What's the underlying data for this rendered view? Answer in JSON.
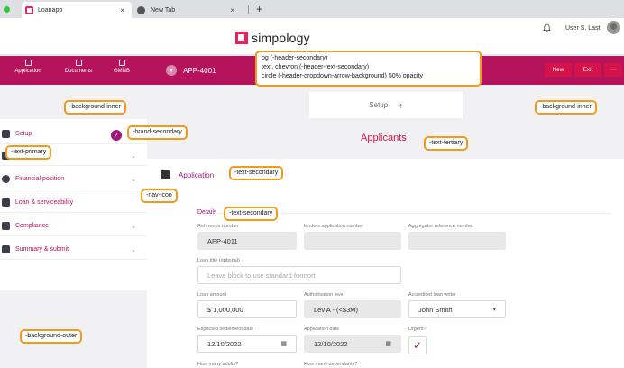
{
  "browser": {
    "tabs": [
      {
        "title": "Loanapp",
        "close": "×"
      },
      {
        "title": "New Tab",
        "close": "×"
      }
    ],
    "new_tab": "+"
  },
  "topbar": {
    "logo_text": "simpology",
    "user_name": "User S. Last"
  },
  "header": {
    "nav": [
      {
        "label": "Application",
        "icon": "application-icon"
      },
      {
        "label": "Documents",
        "icon": "documents-icon"
      },
      {
        "label": "GMNB",
        "icon": "gmnb-icon"
      }
    ],
    "app_id": "APP-4001",
    "buttons": {
      "new": "New",
      "exit": "Exit",
      "more": "···"
    }
  },
  "sidebar": {
    "items": [
      {
        "label": "Setup",
        "chevron": ""
      },
      {
        "label": "",
        "chevron": "⌄"
      },
      {
        "label": "Financial position",
        "chevron": "⌄"
      },
      {
        "label": "Loan & serviceability",
        "chevron": ""
      },
      {
        "label": "Compliance",
        "chevron": "⌄"
      },
      {
        "label": "Summary & submit",
        "chevron": "⌄"
      }
    ]
  },
  "main": {
    "setup_bar": "Setup",
    "setup_arrow": "↑",
    "section_title": "Applicants",
    "application_heading": "Application",
    "details_heading": "Details",
    "fields": {
      "reference_number": {
        "label": "Reference number",
        "value": "APP-4011"
      },
      "lenders_application_number": {
        "label": "lenders application number",
        "value": ""
      },
      "aggregator_reference_number": {
        "label": "Aggregator reference number",
        "value": ""
      },
      "loan_title": {
        "label": "Loan title (optional)",
        "placeholder": "Leave block to use standard formort"
      },
      "loan_amount": {
        "label": "Loan amount",
        "value": "$  1,000,000"
      },
      "authorisation_level": {
        "label": "Authorisation level",
        "value": "Lev A - (<$3M)"
      },
      "accredited_loan_writer": {
        "label": "Accredited loan writer",
        "value": "John Smith"
      },
      "expected_settlement_date": {
        "label": "Expected settlement date",
        "value": "12/10/2022"
      },
      "application_date": {
        "label": "Application date",
        "value": "12/10/2022"
      },
      "urgent": {
        "label": "Urgent?",
        "checked": true
      },
      "how_many_adults": {
        "label": "How many adults?"
      },
      "how_many_dependants": {
        "label": "How many dependants?"
      }
    }
  },
  "annotations": {
    "header_secondary": [
      "bg (-header-secondary)",
      "text, chevron (-header-text-secondary)",
      "circle (-header-dropdown-arrow-background) 50% opacity"
    ],
    "background_inner_left": "-background-inner",
    "background_inner_right": "-background-inner",
    "brand_secondary": "-brand-secondary",
    "text_primary": "-text-primary",
    "text_tertiary": "-text-tertiary",
    "text_secondary_app": "-text-secondary",
    "nav_icon": "-nav-icon",
    "text_secondary_details": "-text-secondary",
    "background_outer": "-background-outer"
  }
}
